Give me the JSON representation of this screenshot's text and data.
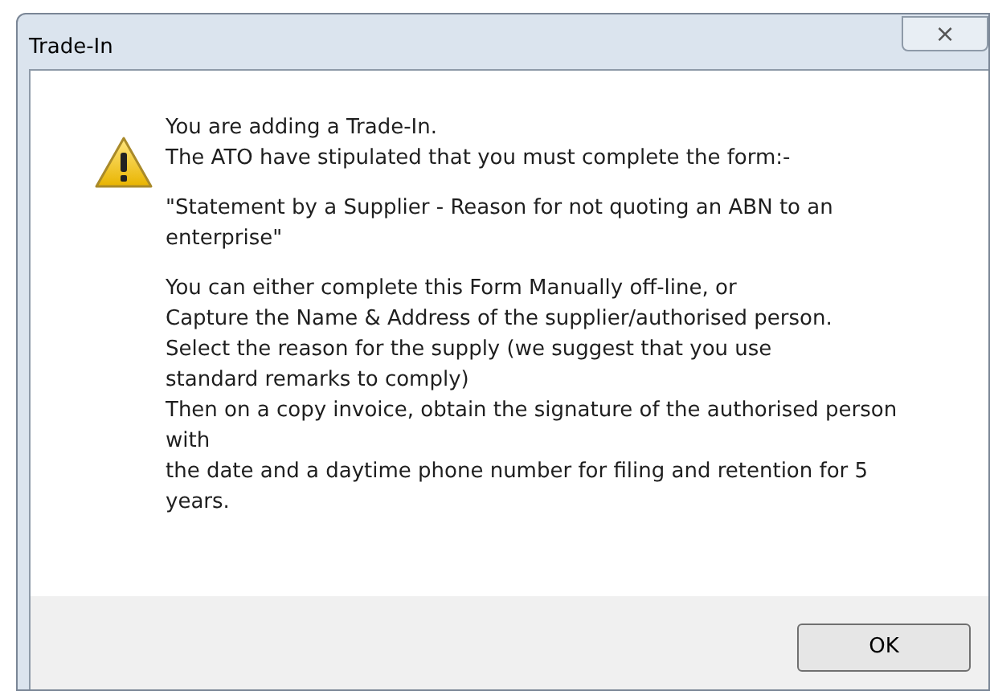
{
  "window": {
    "title": "Trade-In",
    "close_glyph": "⨯"
  },
  "message": {
    "paragraphs": [
      [
        "You are adding a Trade-In.",
        "The ATO have stipulated that you must complete the form:-"
      ],
      [
        "\"Statement by a Supplier - Reason for not quoting an ABN to an",
        "enterprise\""
      ],
      [
        "You can either complete this Form Manually off-line, or",
        "Capture the Name & Address of the supplier/authorised person.",
        "Select the reason for the supply (we suggest that you use",
        "standard remarks to comply)",
        "Then on a copy invoice, obtain the signature of the authorised person",
        "with",
        "the date and a daytime phone number for filing and retention for 5",
        "years."
      ]
    ]
  },
  "buttons": [
    {
      "label": "OK"
    }
  ]
}
